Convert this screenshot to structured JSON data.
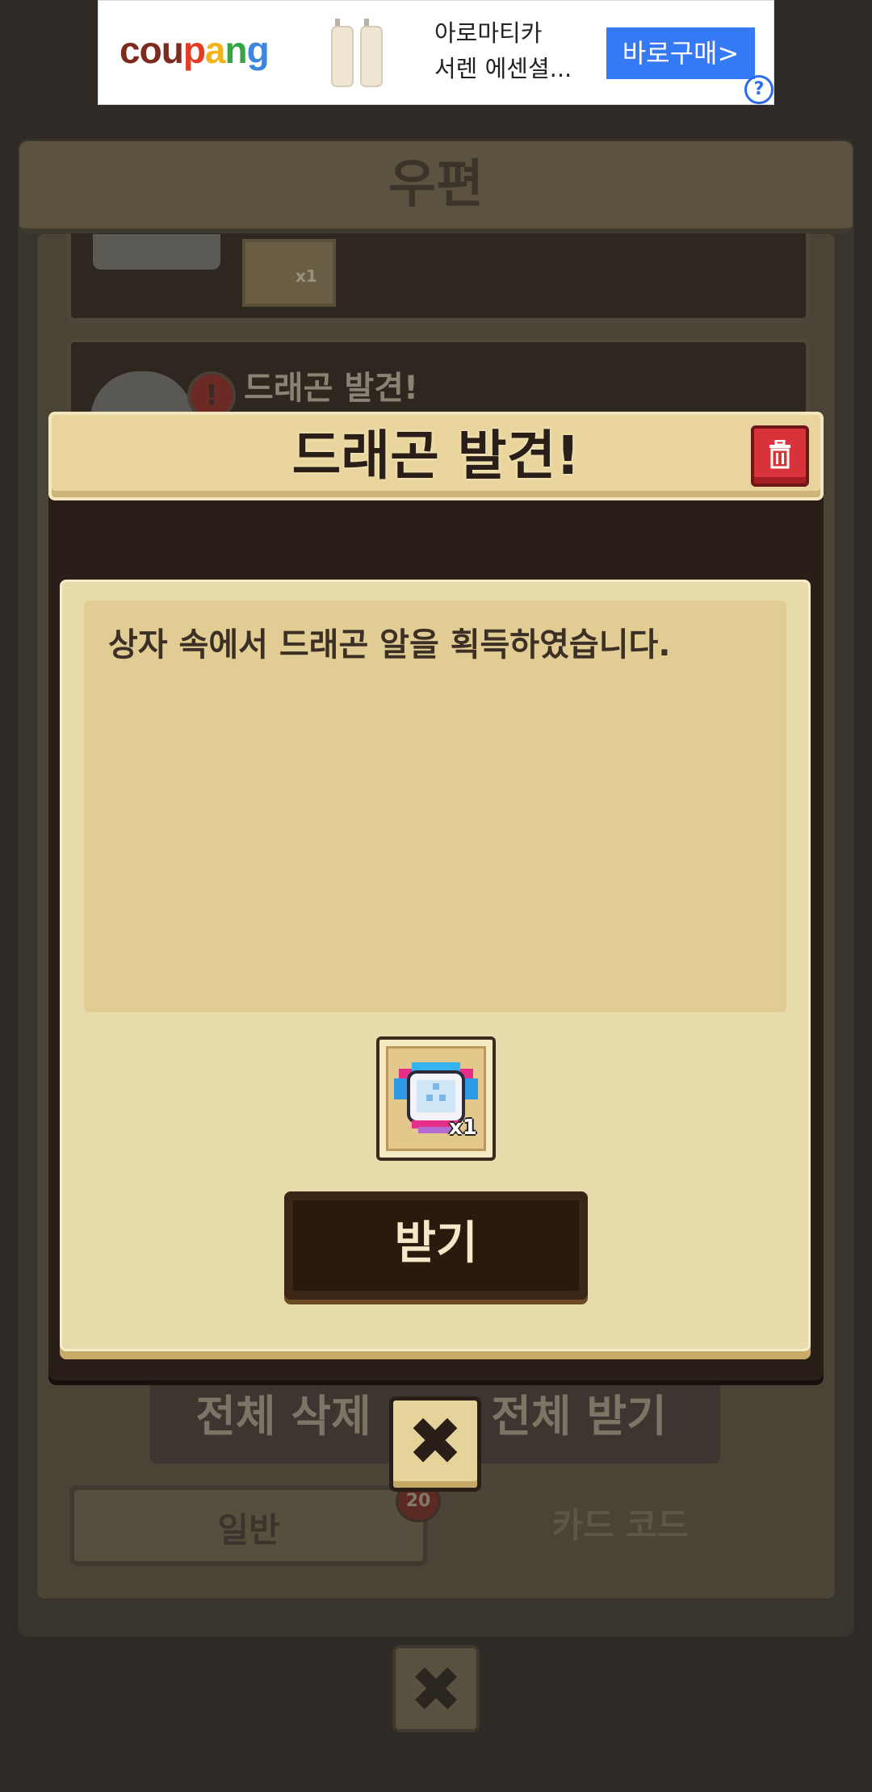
{
  "ad": {
    "logo": [
      "c",
      "o",
      "u",
      "p",
      "a",
      "n",
      "g"
    ],
    "logo_colors": [
      "#7c2b1e",
      "#7c2b1e",
      "#7c2b1e",
      "#e53b25",
      "#f2b418",
      "#36a545",
      "#3d86e0"
    ],
    "product_line1": "아로마티카",
    "product_line2": "서렌 에센셜...",
    "buy_label": "바로구매>",
    "help_label": "?"
  },
  "mail": {
    "title": "우편",
    "row1_qty": "x1",
    "row2_title": "드래곤 발견!",
    "row2_alert": "!",
    "delete_all": "전체 삭제",
    "receive_all": "전체 받기",
    "tab_general": "일반",
    "tab_card_code": "카드 코드",
    "badge": "20",
    "close_icon": "✖"
  },
  "dialog": {
    "title": "드래곤 발견!",
    "message": "상자 속에서 드래곤 알을 획득하였습니다.",
    "reward_qty": "x1",
    "reward_icon": "dragon-egg-icon",
    "receive_label": "받기",
    "close_icon": "✖"
  }
}
